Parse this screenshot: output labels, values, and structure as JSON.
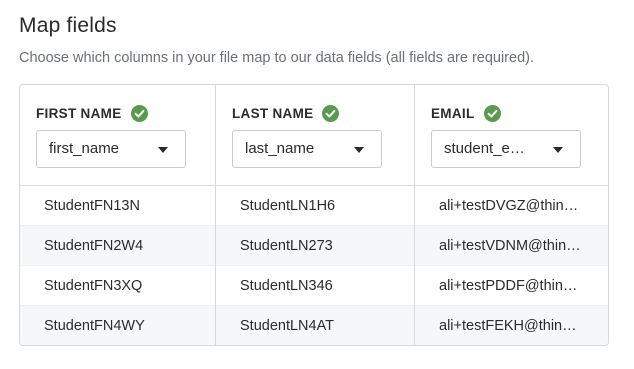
{
  "header": {
    "title": "Map fields",
    "subtitle": "Choose which columns in your file map to our data fields (all fields are required)."
  },
  "columns": [
    {
      "label": "FIRST NAME",
      "status_icon": "check-circle-icon",
      "selected": "first_name",
      "cells": [
        "StudentFN13N",
        "StudentFN2W4",
        "StudentFN3XQ",
        "StudentFN4WY"
      ]
    },
    {
      "label": "LAST NAME",
      "status_icon": "check-circle-icon",
      "selected": "last_name",
      "cells": [
        "StudentLN1H6",
        "StudentLN273",
        "StudentLN346",
        "StudentLN4AT"
      ]
    },
    {
      "label": "EMAIL",
      "status_icon": "check-circle-icon",
      "selected": "student_e…",
      "cells": [
        "ali+testDVGZ@thin…",
        "ali+testVDNM@thin…",
        "ali+testPDDF@thin…",
        "ali+testFEKH@thin…"
      ]
    }
  ],
  "colors": {
    "check": "#5a9a4f",
    "border": "#d6d8dc",
    "alt_row": "#f6f7f9",
    "muted_text": "#6b6f76"
  }
}
